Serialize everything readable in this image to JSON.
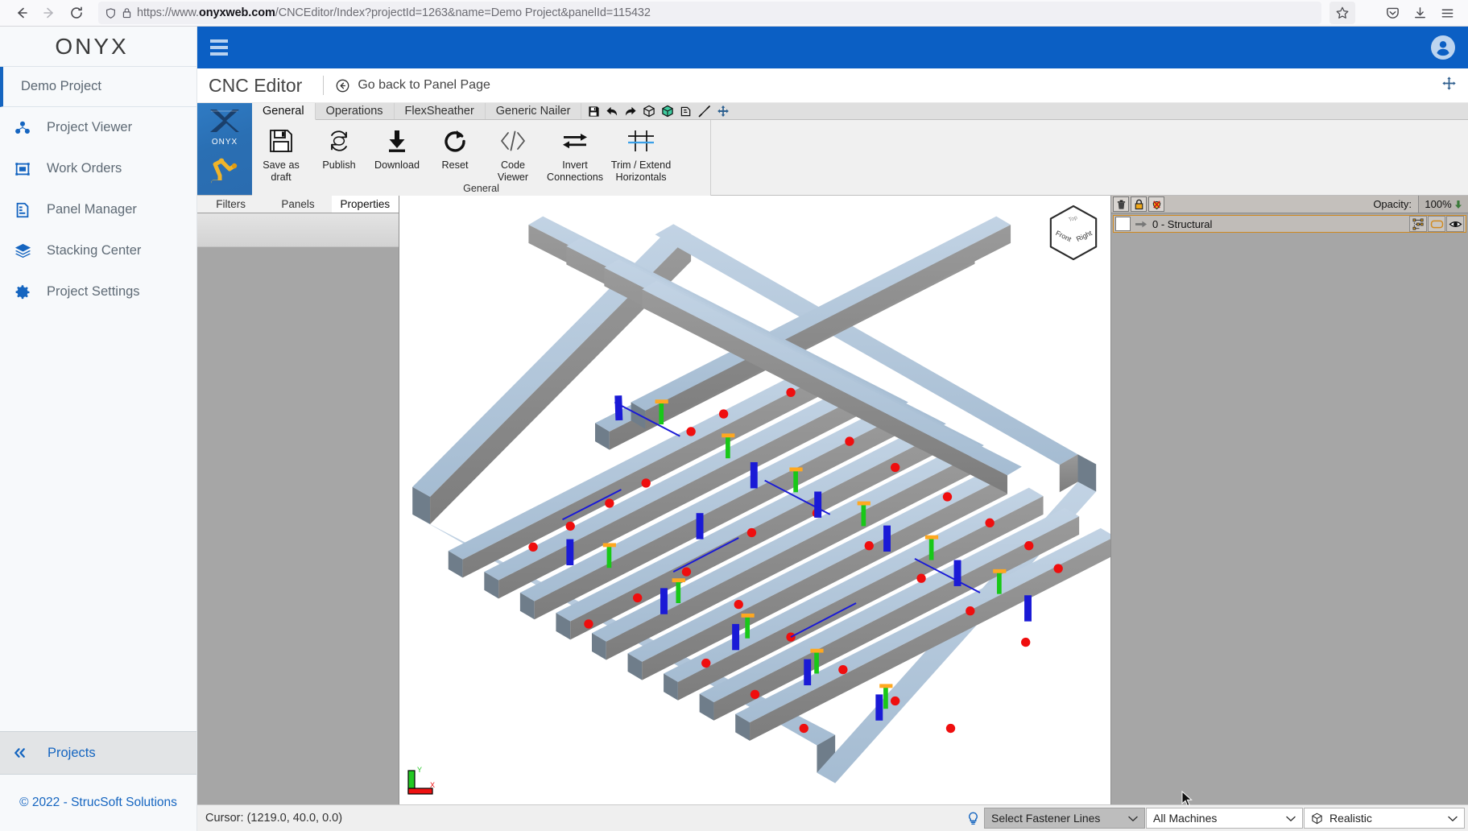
{
  "browser": {
    "back_icon": "back-arrow-icon",
    "forward_icon": "forward-arrow-icon",
    "reload_icon": "reload-icon",
    "shield_icon": "shield-icon",
    "lock_icon": "lock-icon",
    "url_prefix": "https://www.",
    "url_domain": "onyxweb.com",
    "url_suffix": "/CNCEditor/Index?projectId=1263&name=Demo Project&panelId=115432",
    "url_full": "https://www.onyxweb.com/CNCEditor/Index?projectId=1263&name=Demo Project&panelId=115432",
    "bookmark_icon": "star-icon",
    "pocket_icon": "pocket-icon",
    "downloads_icon": "download-icon",
    "menu_icon": "hamburger-menu-icon"
  },
  "sidebar": {
    "logo": "ONYX",
    "project_name": "Demo Project",
    "items": [
      {
        "label": "Project Viewer",
        "icon": "project-viewer-icon"
      },
      {
        "label": "Work Orders",
        "icon": "work-orders-icon"
      },
      {
        "label": "Panel Manager",
        "icon": "panel-manager-icon"
      },
      {
        "label": "Stacking Center",
        "icon": "stacking-center-icon"
      },
      {
        "label": "Project Settings",
        "icon": "gear-icon"
      }
    ],
    "projects_label": "Projects",
    "collapse_icon": "double-chevron-left-icon",
    "copyright": "© 2022 - StrucSoft Solutions",
    "accent_color": "#1565c0"
  },
  "appbar": {
    "menu_icon": "hamburger-menu-icon",
    "account_icon": "user-account-icon",
    "background_color": "#0b5fc4"
  },
  "editor_header": {
    "title": "CNC Editor",
    "back_link": "Go back to Panel Page",
    "back_icon": "circle-back-arrow-icon",
    "move_icon": "move-handle-icon"
  },
  "ribbon": {
    "logo_label": "ONYX",
    "tabs": [
      {
        "label": "General",
        "active": true
      },
      {
        "label": "Operations",
        "active": false
      },
      {
        "label": "FlexSheather",
        "active": false
      },
      {
        "label": "Generic Nailer",
        "active": false
      }
    ],
    "quick_access": [
      "save-floppy-icon",
      "undo-arrow-icon",
      "redo-arrow-icon",
      "box-outline-icon",
      "box-filled-green-icon",
      "copy-icon",
      "dimension-line-icon",
      "move-cross-icon"
    ],
    "group_label": "General",
    "buttons": [
      {
        "label": "Save as draft",
        "icon": "save-floppy-icon"
      },
      {
        "label": "Publish",
        "icon": "publish-refresh-icon"
      },
      {
        "label": "Download",
        "icon": "download-arrow-icon"
      },
      {
        "label": "Reset",
        "icon": "reset-circular-arrow-icon"
      },
      {
        "label": "Code Viewer",
        "icon": "code-brackets-icon"
      },
      {
        "label": "Invert Connections",
        "icon": "invert-arrows-icon"
      },
      {
        "label": "Trim / Extend Horizontals",
        "icon": "trim-extend-icon"
      }
    ]
  },
  "left_panel": {
    "tabs": [
      {
        "label": "Filters",
        "active": false
      },
      {
        "label": "Panels",
        "active": false
      },
      {
        "label": "Properties",
        "active": true
      }
    ]
  },
  "right_panel": {
    "tools": [
      "delete-layer-icon",
      "lock-layer-icon",
      "mask-layer-icon"
    ],
    "opacity_label": "Opacity:",
    "opacity_value": "100%",
    "opacity_caret": "down-arrow-icon",
    "layers": [
      {
        "name": "0 - Structural",
        "arrow_icon": "arrow-right-icon",
        "icons": [
          "nodes-icon",
          "outline-icon",
          "eye-visibility-icon"
        ]
      }
    ],
    "highlight_color": "#d08a20"
  },
  "viewport": {
    "viewcube": {
      "top": "Top",
      "front": "Front",
      "right": "Right"
    },
    "axis": {
      "x": "X",
      "y": "Y",
      "x_color": "#ff0000",
      "y_color": "#00c000"
    },
    "model_colors": {
      "member_face": "#aec4da",
      "member_web": "#8d8d8d",
      "fastener_red": "#f01010",
      "marker_blue": "#1414d2",
      "marker_green": "#18c818",
      "marker_orange": "#ffa820"
    }
  },
  "status_bar": {
    "cursor": "Cursor: (1219.0, 40.0, 0.0)",
    "bulb_icon": "lightbulb-icon",
    "selects": [
      {
        "label": "Select Fastener Lines",
        "icon": "",
        "style": "gray"
      },
      {
        "label": "All Machines",
        "icon": "",
        "style": "white"
      },
      {
        "label": "Realistic",
        "icon": "cube-icon",
        "style": "white"
      }
    ],
    "caret_icon": "chevron-down-icon"
  }
}
